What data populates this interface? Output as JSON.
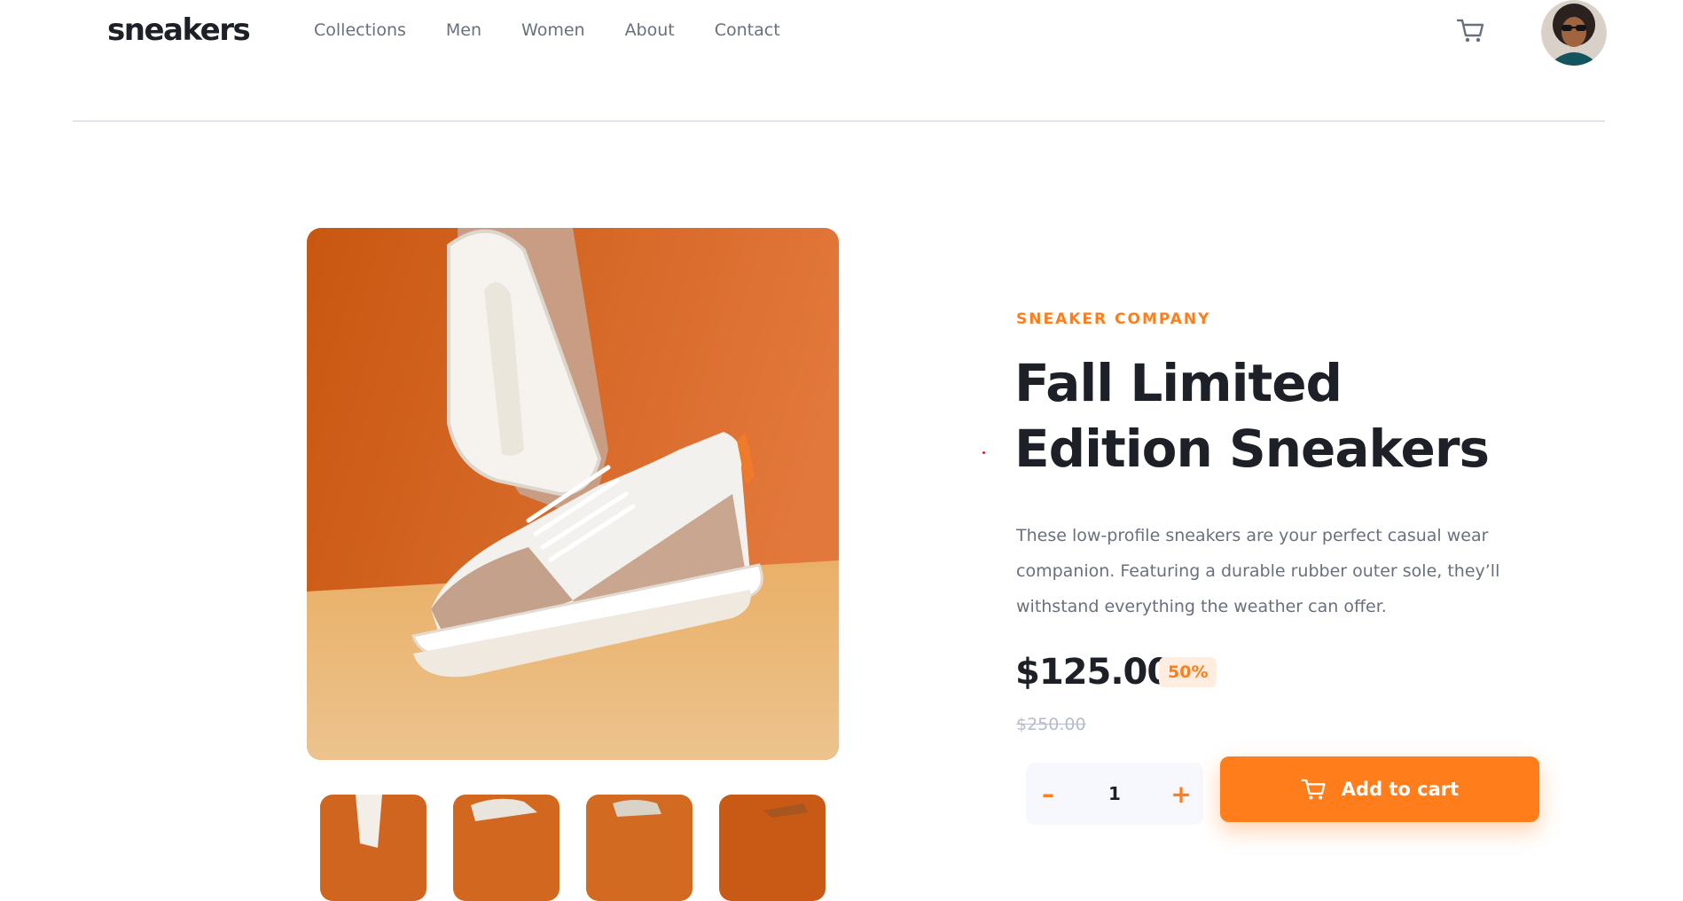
{
  "header": {
    "logo": "sneakers",
    "nav": [
      "Collections",
      "Men",
      "Women",
      "About",
      "Contact"
    ],
    "cart_icon": "cart-icon",
    "avatar_icon": "user-avatar"
  },
  "gallery": {
    "main_image": "sneaker-product-photo",
    "thumbnails": [
      "thumbnail-1",
      "thumbnail-2",
      "thumbnail-3",
      "thumbnail-4"
    ]
  },
  "product": {
    "company": "SNEAKER COMPANY",
    "title": "Fall Limited Edition Sneakers",
    "description": "These low-profile sneakers are your perfect casual wear companion. Featuring a durable rubber outer sole, they’ll withstand everything the weather can offer.",
    "price": "$125.00",
    "discount": "50%",
    "old_price": "$250.00",
    "quantity": "1",
    "minus": "–",
    "plus": "+",
    "add_to_cart": "Add to cart"
  },
  "colors": {
    "accent": "#ff7d1a",
    "accent_pale": "#ffede0",
    "text_dark": "#1d2026",
    "text_grey": "#69707d"
  }
}
